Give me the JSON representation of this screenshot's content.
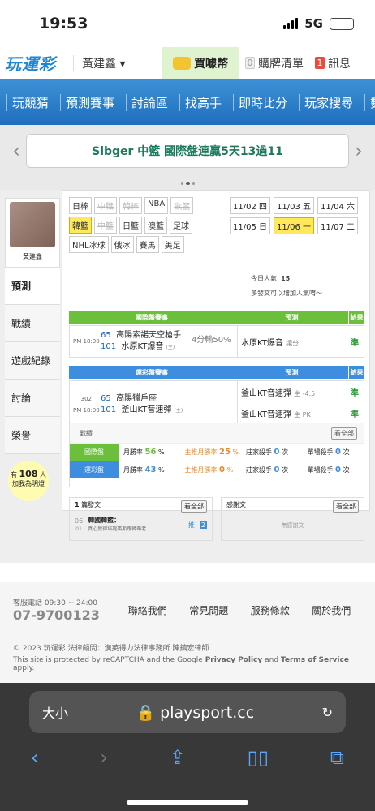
{
  "status": {
    "time": "19:53",
    "network": "5G"
  },
  "topnav": {
    "logo": "玩運彩",
    "user": "黃建鑫",
    "buy": "買噱幣",
    "cart": "購牌清單",
    "cart_count": "0",
    "message": "訊息",
    "message_count": "1"
  },
  "mainnav": [
    "玩競猜",
    "預測賽事",
    "討論區",
    "找高手",
    "即時比分",
    "玩家搜尋",
    "數據"
  ],
  "banner": {
    "text": "Sibger 中籃 國際盤連贏5天13過11"
  },
  "profile": {
    "name": "黃建鑫"
  },
  "sidemenu": [
    "預測",
    "戰績",
    "遊戲紀錄",
    "討論",
    "榮譽"
  ],
  "helpers": {
    "count_text": "有",
    "count": "108",
    "unit": "人",
    "sub": "加我為明燈"
  },
  "leagues": [
    {
      "label": "日棒",
      "state": "normal"
    },
    {
      "label": "中職",
      "state": "dis"
    },
    {
      "label": "韓棒",
      "state": "dis"
    },
    {
      "label": "NBA",
      "state": "normal"
    },
    {
      "label": "歐籃",
      "state": "dis"
    },
    {
      "label": "韓籃",
      "state": "sel"
    },
    {
      "label": "中籃",
      "state": "dis"
    },
    {
      "label": "日籃",
      "state": "normal"
    },
    {
      "label": "澳籃",
      "state": "normal"
    },
    {
      "label": "足球",
      "state": "normal"
    },
    {
      "label": "NHL冰球",
      "state": "normal"
    },
    {
      "label": "俄冰",
      "state": "normal"
    },
    {
      "label": "賽馬",
      "state": "normal"
    },
    {
      "label": "美足",
      "state": "normal"
    }
  ],
  "dates": [
    {
      "label": "11/02 四",
      "sel": false
    },
    {
      "label": "11/03 五",
      "sel": false
    },
    {
      "label": "11/04 六",
      "sel": false
    },
    {
      "label": "11/05 日",
      "sel": false
    },
    {
      "label": "11/06 一",
      "sel": true
    },
    {
      "label": "11/07 二",
      "sel": false
    }
  ],
  "popularity": {
    "label": "今日人氣",
    "value": "15",
    "note": "多發文可以增加人氣唷～"
  },
  "intl": {
    "h1": "國際盤賽事",
    "h2": "預測",
    "h3": "結果",
    "time": "PM 18:00",
    "n1": "65",
    "t1": "高陽索諾天空槍手",
    "n2": "101",
    "t2": "水原KT爆音",
    "t2tag": "(主)",
    "odds": "4分輸50%",
    "pick": "水原KT爆音",
    "pick_type": "讓分",
    "res": "準"
  },
  "lottery": {
    "h1": "運彩盤賽事",
    "h2": "預測",
    "h3": "結果",
    "id": "302",
    "time": "PM 18:00",
    "n1": "65",
    "t1": "高陽獵戶座",
    "n2": "101",
    "t2": "釜山KT音速彈",
    "t2tag": "(主)",
    "p1": "釜山KT音速彈",
    "p1d": "主 -4.5",
    "p2": "釜山KT音速彈",
    "p2d": "主 PK",
    "r1": "準",
    "r2": "準"
  },
  "stats": {
    "title": "戰績",
    "all": "看全部",
    "rows": [
      {
        "label": "國際盤",
        "m": "月勝率",
        "mv": "56",
        "ms": "%",
        "z": "主推月勝率",
        "zv": "25",
        "zs": "%",
        "k": "莊家殺手",
        "kv": "0",
        "ks": "次",
        "s": "單場殺手",
        "sv": "0",
        "ss": "次"
      },
      {
        "label": "運彩盤",
        "m": "月勝率",
        "mv": "43",
        "ms": "%",
        "z": "主推月勝率",
        "zv": "0",
        "zs": "%",
        "k": "莊家殺手",
        "kv": "0",
        "ks": "次",
        "s": "單場殺手",
        "sv": "0",
        "ss": "次"
      }
    ]
  },
  "posts": {
    "left_title_num": "1",
    "left_title": "篇發文",
    "all": "看全部",
    "date_d": "06",
    "date_m": "01",
    "post_title": "韓國韓籃：",
    "post_sub": "真心覺得培提裘斯跟韓蒂老...",
    "post_tag": "推",
    "post_count": "2",
    "right_title": "感謝文",
    "right_all": "看全部",
    "right_empty": "無感謝文"
  },
  "footer": {
    "service": "客服電話 09:30 ~ 24:00",
    "phone": "07-9700123",
    "links": [
      "聯絡我們",
      "常見問題",
      "服務條款",
      "關於我們"
    ],
    "copy": "© 2023 玩運彩  法律顧問：漢英得力法律事務所 陳鎮宏律師",
    "cap_pre": "This site is protected by reCAPTCHA and the Google",
    "cap_pp": "Privacy Policy",
    "cap_and": "and",
    "cap_tos": "Terms of Service",
    "cap_post": "apply."
  },
  "browser": {
    "aa": "大小",
    "url": "playsport.cc"
  }
}
